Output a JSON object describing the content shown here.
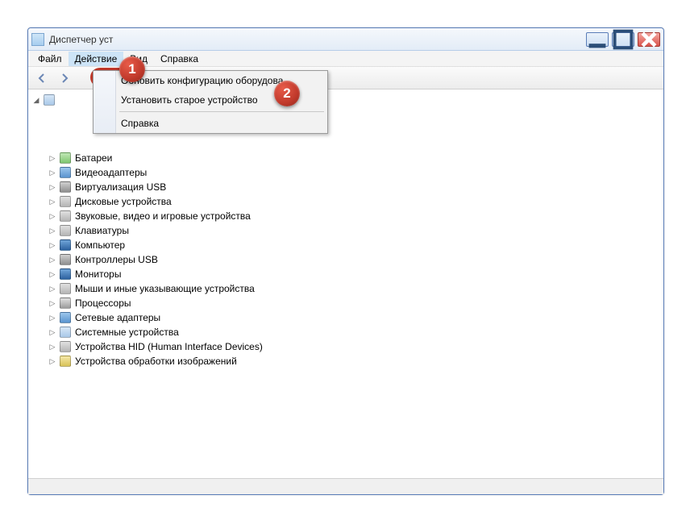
{
  "window": {
    "title": "Диспетчер уст"
  },
  "menubar": {
    "file": "Файл",
    "action": "Действие",
    "view": "Вид",
    "help": "Справка"
  },
  "dropdown": {
    "update_config": "Обновить конфигурацию оборудова",
    "legacy_hardware": "Установить старое устройство",
    "help": "Справка"
  },
  "tree": {
    "items": [
      {
        "label": "Батареи",
        "icon": "ico-green"
      },
      {
        "label": "Видеоадаптеры",
        "icon": "ico-blue"
      },
      {
        "label": "Виртуализация USB",
        "icon": "ico-usb"
      },
      {
        "label": "Дисковые устройства",
        "icon": "ico-gray"
      },
      {
        "label": "Звуковые, видео и игровые устройства",
        "icon": "ico-gray"
      },
      {
        "label": "Клавиатуры",
        "icon": "ico-gray"
      },
      {
        "label": "Компьютер",
        "icon": "ico-mon"
      },
      {
        "label": "Контроллеры USB",
        "icon": "ico-usb"
      },
      {
        "label": "Мониторы",
        "icon": "ico-mon"
      },
      {
        "label": "Мыши и иные указывающие устройства",
        "icon": "ico-gray"
      },
      {
        "label": "Процессоры",
        "icon": "ico-cpu"
      },
      {
        "label": "Сетевые адаптеры",
        "icon": "ico-blue"
      },
      {
        "label": "Системные устройства",
        "icon": "ico-pc"
      },
      {
        "label": "Устройства HID (Human Interface Devices)",
        "icon": "ico-gray"
      },
      {
        "label": "Устройства обработки изображений",
        "icon": "ico-yellow"
      }
    ]
  },
  "annotations": {
    "bubble1": "1",
    "bubble2": "2"
  }
}
